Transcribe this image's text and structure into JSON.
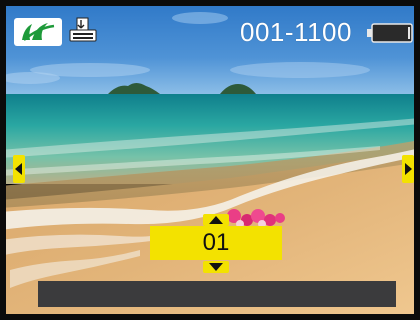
{
  "status_bar": {
    "mode_icon": "playback-mode-icon",
    "print_icon": "print-icon",
    "file_number": "001-1100",
    "battery_icon": "battery-icon",
    "battery_level": 0.05
  },
  "navigation": {
    "previous_icon": "arrow-left-icon",
    "next_icon": "arrow-right-icon"
  },
  "copies": {
    "value": "01",
    "increase_icon": "arrow-up-icon",
    "decrease_icon": "arrow-down-icon"
  },
  "colors": {
    "accent_yellow": "#F3E200",
    "mode_icon_green": "#1E9A3A",
    "bar_gray": "#3B3B3D"
  }
}
